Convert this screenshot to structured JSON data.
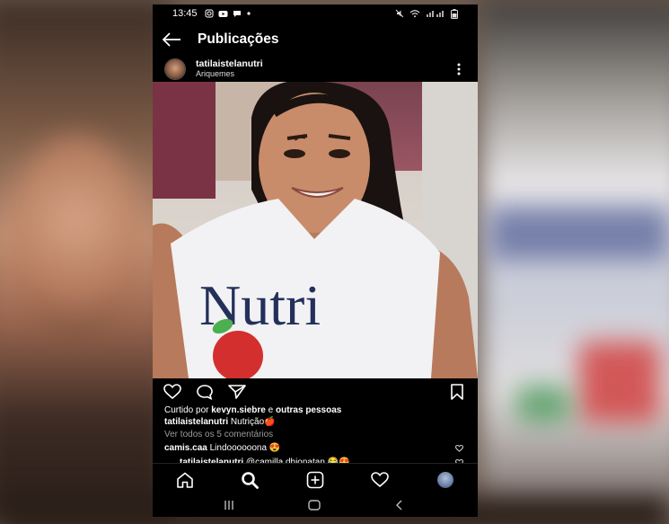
{
  "status_bar": {
    "time": "13:45",
    "left_icons": [
      "instagram-icon",
      "youtube-icon",
      "message-icon",
      "dot-icon"
    ],
    "right_icons": [
      "mute-icon",
      "wifi-icon",
      "signal-icon",
      "battery-icon"
    ]
  },
  "header": {
    "title": "Publicações"
  },
  "post": {
    "username": "tatilaistelanutri",
    "location": "Ariquemes",
    "shirt_text": "Nutri",
    "liked_prefix": "Curtido por ",
    "liked_user": "kevyn.siebre",
    "liked_mid": " e ",
    "liked_others": "outras pessoas",
    "caption_user": "tatilaistelanutri",
    "caption_text": " Nutrição🍎",
    "view_comments": "Ver todos os 5 comentários",
    "comments": [
      {
        "user": "camis.caa",
        "text": " Lindoooooona 😍"
      },
      {
        "user": "tatilaistelanutri",
        "text": " @camilla.dhionatan 😂😍"
      }
    ]
  },
  "colors": {
    "background": "#000000",
    "text": "#ffffff",
    "muted": "#9a9a9a",
    "accent_red": "#d32f2f"
  }
}
